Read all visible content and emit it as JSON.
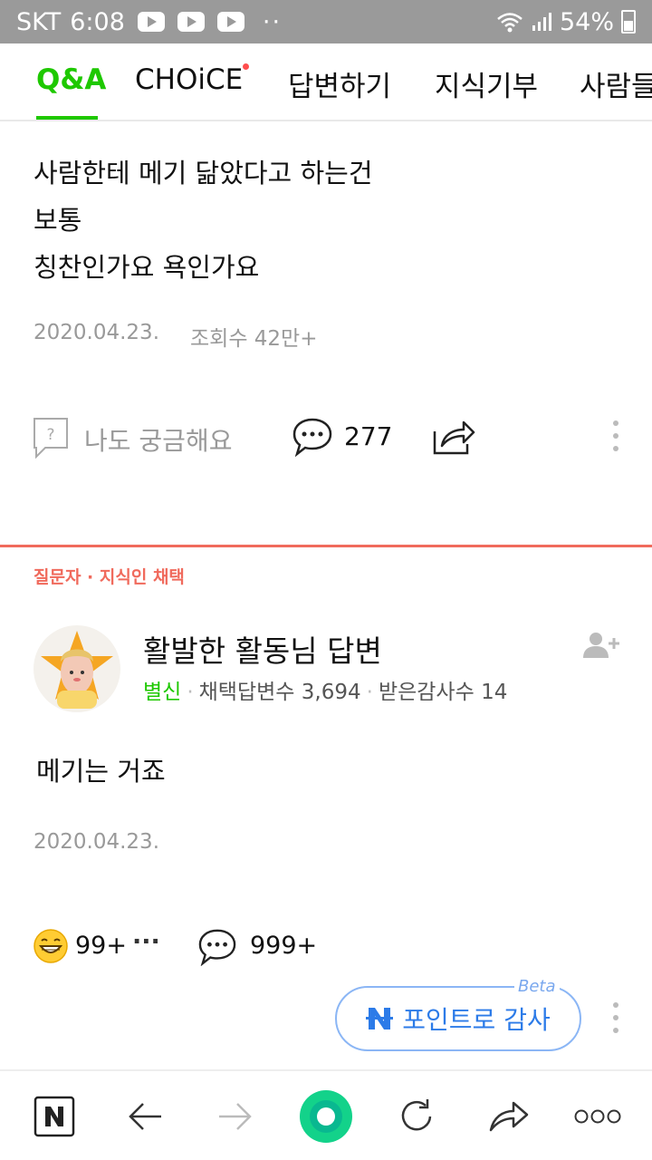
{
  "status_bar": {
    "carrier": "SKT",
    "time": "6:08",
    "overflow": "··",
    "battery": "54%"
  },
  "tabs": [
    {
      "label": "Q&A",
      "active": true
    },
    {
      "label": "CHOiCE",
      "active": false,
      "new_dot": true
    },
    {
      "label": "답변하기",
      "active": false
    },
    {
      "label": "지식기부",
      "active": false
    },
    {
      "label": "사람들",
      "active": false
    }
  ],
  "question": {
    "lines": [
      "사람한테 메기 닮았다고 하는건",
      "보통",
      "칭찬인가요 욕인가요"
    ],
    "date": "2020.04.23.",
    "views": "조회수 42만+",
    "curious_label": "나도 궁금해요",
    "comment_count": "277"
  },
  "answer": {
    "badge": "질문자 · 지식인 채택",
    "author": "활발한 활동님 답변",
    "grade": "별신",
    "adopted_label": "채택답변수",
    "adopted_count": "3,694",
    "thanks_label": "받은감사수",
    "thanks_count": "14",
    "body": "메기는 거죠",
    "date": "2020.04.23.",
    "reaction_count": "99+",
    "more_reactions": "···",
    "comment_count": "999+",
    "point_thanks_label": "포인트로 감사",
    "beta_label": "Beta"
  },
  "colors": {
    "brand_green": "#1ec800",
    "accent_red": "#f06a5c",
    "point_blue": "#2c7be8",
    "status_bar": "#9a9a9a"
  },
  "icons": [
    "question-box-icon",
    "comment-bubble-icon",
    "share-icon",
    "add-friend-icon",
    "grin-emoji-icon",
    "naver-n-icon",
    "back-arrow-icon",
    "forward-arrow-icon",
    "home-green-circle-icon",
    "refresh-icon",
    "share-arrow-icon",
    "more-dots-icon"
  ]
}
